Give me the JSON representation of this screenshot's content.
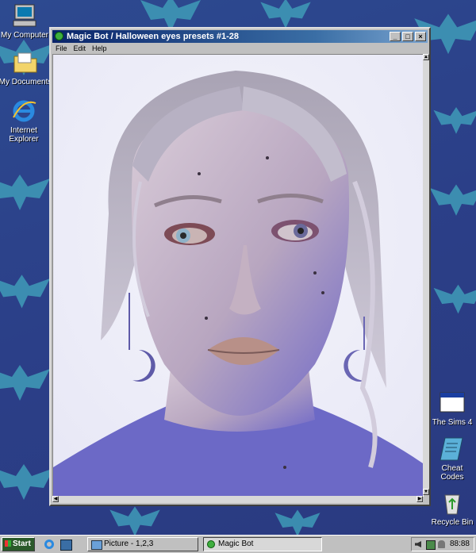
{
  "desktop": {
    "icons": [
      {
        "label_line1": "My Computer",
        "label_line2": ""
      },
      {
        "label_line1": "My Documents",
        "label_line2": ""
      },
      {
        "label_line1": "Internet",
        "label_line2": "Explorer"
      },
      {
        "label_line1": "The Sims 4",
        "label_line2": ""
      },
      {
        "label_line1": "Cheat",
        "label_line2": "Codes"
      },
      {
        "label_line1": "Recycle Bin",
        "label_line2": ""
      }
    ],
    "wallpaper_color": "#2b3f88",
    "bat_color": "#3f9bb8"
  },
  "window": {
    "title": "Magic Bot / Halloween eyes presets #1-28",
    "menu": [
      "File",
      "Edit",
      "Help"
    ],
    "title_gradient_start": "#0a246a",
    "title_gradient_end": "#7aa4d0"
  },
  "taskbar": {
    "start_label": "Start",
    "tasks": [
      {
        "label": "Picture - 1,2,3"
      },
      {
        "label": "Magic Bot"
      }
    ],
    "clock": "88:88"
  }
}
